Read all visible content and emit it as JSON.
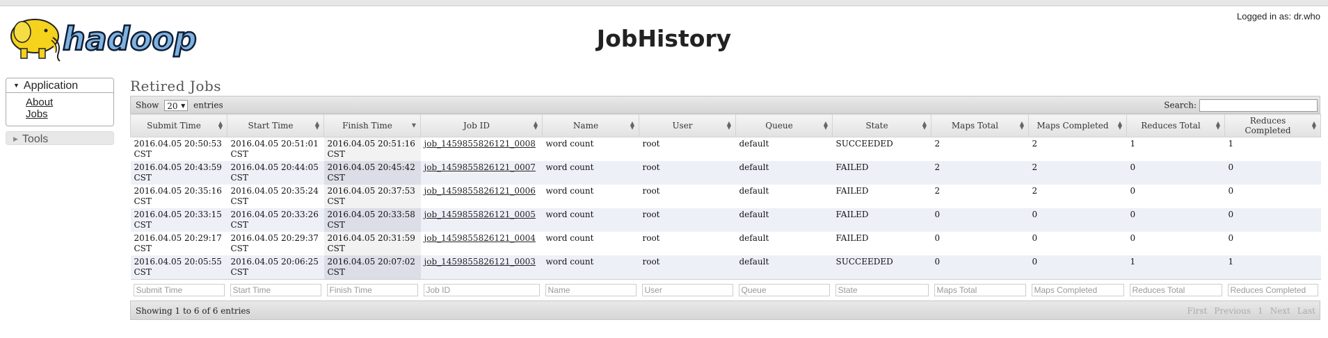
{
  "header": {
    "logo_text": "hadoop",
    "title": "JobHistory",
    "logged_in": "Logged in as: dr.who"
  },
  "sidebar": {
    "application_label": "Application",
    "links": [
      "About",
      "Jobs"
    ],
    "tools_label": "Tools"
  },
  "main": {
    "section_title": "Retired Jobs",
    "show_label": "Show",
    "page_length": "20",
    "entries_label": "entries",
    "search_label": "Search:",
    "columns": [
      "Submit Time",
      "Start Time",
      "Finish Time",
      "Job ID",
      "Name",
      "User",
      "Queue",
      "State",
      "Maps Total",
      "Maps Completed",
      "Reduces Total",
      "Reduces Completed"
    ],
    "rows": [
      [
        "2016.04.05 20:50:53 CST",
        "2016.04.05 20:51:01 CST",
        "2016.04.05 20:51:16 CST",
        "job_1459855826121_0008",
        "word count",
        "root",
        "default",
        "SUCCEEDED",
        "2",
        "2",
        "1",
        "1"
      ],
      [
        "2016.04.05 20:43:59 CST",
        "2016.04.05 20:44:05 CST",
        "2016.04.05 20:45:42 CST",
        "job_1459855826121_0007",
        "word count",
        "root",
        "default",
        "FAILED",
        "2",
        "2",
        "0",
        "0"
      ],
      [
        "2016.04.05 20:35:16 CST",
        "2016.04.05 20:35:24 CST",
        "2016.04.05 20:37:53 CST",
        "job_1459855826121_0006",
        "word count",
        "root",
        "default",
        "FAILED",
        "2",
        "2",
        "0",
        "0"
      ],
      [
        "2016.04.05 20:33:15 CST",
        "2016.04.05 20:33:26 CST",
        "2016.04.05 20:33:58 CST",
        "job_1459855826121_0005",
        "word count",
        "root",
        "default",
        "FAILED",
        "0",
        "0",
        "0",
        "0"
      ],
      [
        "2016.04.05 20:29:17 CST",
        "2016.04.05 20:29:37 CST",
        "2016.04.05 20:31:59 CST",
        "job_1459855826121_0004",
        "word count",
        "root",
        "default",
        "FAILED",
        "0",
        "0",
        "0",
        "0"
      ],
      [
        "2016.04.05 20:05:55 CST",
        "2016.04.05 20:06:25 CST",
        "2016.04.05 20:07:02 CST",
        "job_1459855826121_0003",
        "word count",
        "root",
        "default",
        "SUCCEEDED",
        "0",
        "0",
        "1",
        "1"
      ]
    ],
    "info_text": "Showing 1 to 6 of 6 entries",
    "paging": [
      "First",
      "Previous",
      "1",
      "Next",
      "Last"
    ]
  }
}
